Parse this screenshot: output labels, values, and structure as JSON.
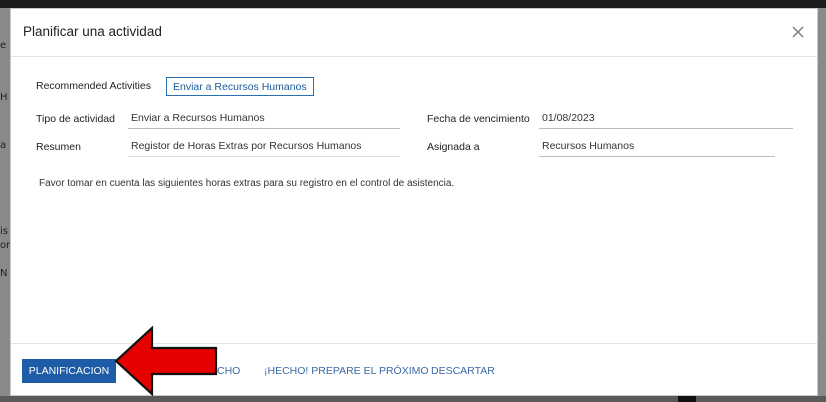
{
  "dialog": {
    "title": "Planificar una actividad",
    "recommended_label": "Recommended Activities",
    "recommended_button": "Enviar a Recursos Humanos",
    "fields": {
      "tipo_label": "Tipo de actividad",
      "tipo_value": "Enviar a Recursos Humanos",
      "fecha_label": "Fecha de vencimiento",
      "fecha_value": "01/08/2023",
      "resumen_label": "Resumen",
      "resumen_value": "Registor de Horas Extras por Recursos Humanos",
      "asignada_label": "Asignada a",
      "asignada_value": "Recursos Humanos"
    },
    "note": "Favor tomar en cuenta las siguientes horas extras para su registro en el control de asistencia."
  },
  "footer": {
    "primary": "PLANIFICACION",
    "hidden_partial": "CHO",
    "next": "¡HECHO! PREPARE EL PRÓXIMO",
    "discard": "DESCARTAR"
  },
  "background_letters": [
    "e",
    "H",
    "a",
    "is",
    "or",
    "N"
  ],
  "colors": {
    "primary": "#1f5ca8",
    "link": "#3a6aa8",
    "arrow": "#e60000"
  }
}
